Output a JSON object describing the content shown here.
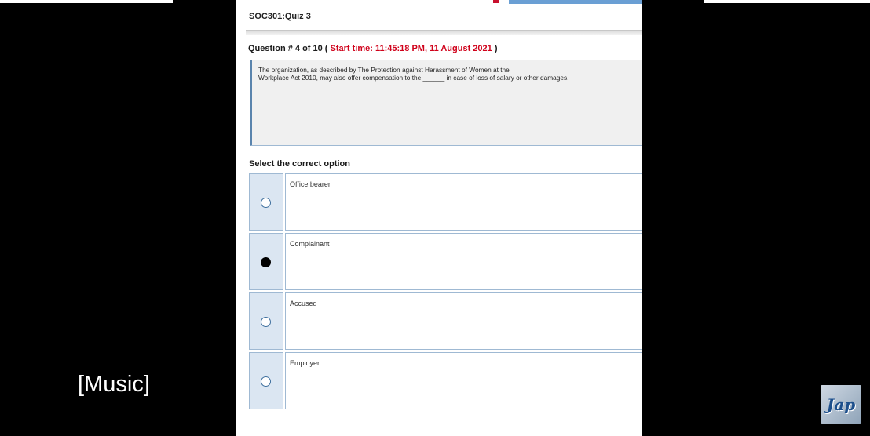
{
  "quiz": {
    "course_title": "SOC301:Quiz 3",
    "question_prefix": "Question # 4 of 10 ( ",
    "start_time": "Start time: 11:45:18 PM, 11 August 2021",
    "question_suffix": " )",
    "question_text_line1": "The organization, as described by The Protection against Harassment of Women at the",
    "question_text_line2": "Workplace Act 2010, may also offer compensation to the ______ in case of loss of salary or other damages.",
    "select_label": "Select the correct option",
    "options": [
      {
        "label": "Office bearer",
        "selected": false
      },
      {
        "label": "Complainant",
        "selected": true
      },
      {
        "label": "Accused",
        "selected": false
      },
      {
        "label": "Employer",
        "selected": false
      }
    ]
  },
  "overlay": {
    "caption": "[Music]",
    "logo_text": "Jap"
  },
  "colors": {
    "start_time": "#d0021b",
    "option_border": "#9fb9d3",
    "radio_cell": "#dbe6f2"
  }
}
